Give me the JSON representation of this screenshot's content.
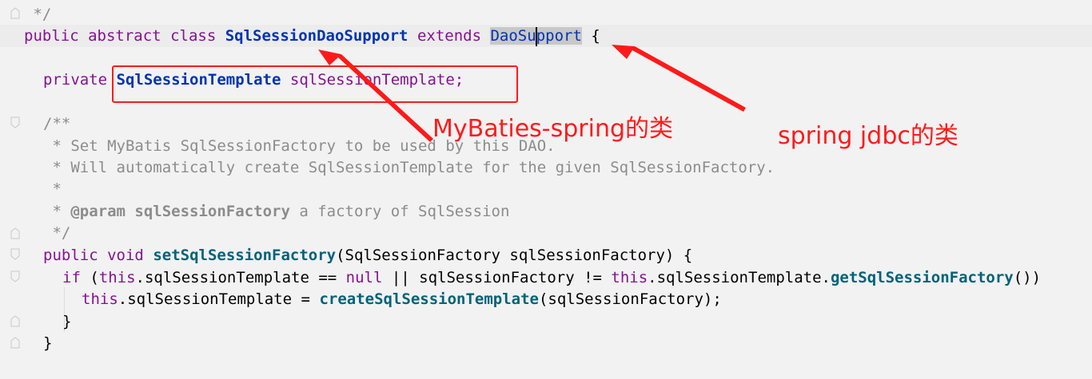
{
  "code": {
    "comment_end_top": " */",
    "line_class_decl": {
      "kw_public": "public",
      "kw_abstract": "abstract",
      "kw_class": "class",
      "class_name": "SqlSessionDaoSupport",
      "kw_extends": "extends",
      "super_part1": "DaoSu",
      "super_part2": "pport",
      "brace": " {"
    },
    "line_field": {
      "kw_private": "private",
      "type": "SqlSessionTemplate",
      "name": "sqlSessionTemplate;"
    },
    "javadoc": [
      "/**",
      " * Set MyBatis SqlSessionFactory to be used by this DAO.",
      " * Will automatically create SqlSessionTemplate for the given SqlSessionFactory.",
      " *"
    ],
    "javadoc_param": {
      "prefix": " * ",
      "tag": "@param",
      "name": "sqlSessionFactory",
      "desc": " a factory of SqlSession"
    },
    "javadoc_end": " */",
    "line_method": {
      "kw_public": "public",
      "kw_void": "void",
      "method": "setSqlSessionFactory",
      "params": "(SqlSessionFactory sqlSessionFactory) {"
    },
    "line_if": {
      "kw_if": "if",
      "p1": " (",
      "this1": "this",
      "f1": ".sqlSessionTemplate == ",
      "null": "null",
      "p2": " || sqlSessionFactory != ",
      "this2": "this",
      "f2": ".sqlSessionTemplate.",
      "m": "getSqlSessionFactory",
      "p3": "())"
    },
    "line_assign": {
      "this": "this",
      "f": ".sqlSessionTemplate = ",
      "m": "createSqlSessionTemplate",
      "args": "(sqlSessionFactory);"
    },
    "close_inner": "}",
    "close_outer": "}"
  },
  "annotations": {
    "mybatis_label": "MyBaties-spring的类",
    "spring_label": "spring jdbc的类",
    "color": "#ff1a1a"
  }
}
